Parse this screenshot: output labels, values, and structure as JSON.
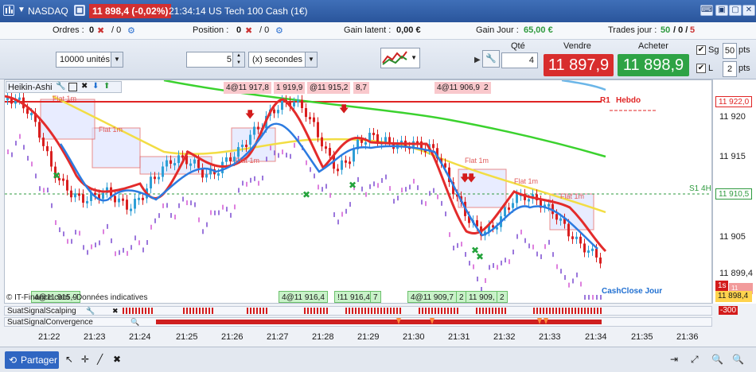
{
  "header": {
    "symbol": "NASDAQ",
    "price_change": "11 898,4 (-0,02%)",
    "title": "21:34:14 US Tech 100 Cash (1€)",
    "buttons": [
      "▣",
      "▢",
      "✕"
    ]
  },
  "stats": {
    "orders_label": "Ordres :",
    "orders_val": "0",
    "orders_pending": "/ 0",
    "position_label": "Position :",
    "position_val": "0",
    "position_pending": "/ 0",
    "gain_latent_label": "Gain latent :",
    "gain_latent_val": "0,00 €",
    "gain_jour_label": "Gain Jour :",
    "gain_jour_val": "65,00 €",
    "trades_label": "Trades jour :",
    "trades_val_1": "50",
    "trades_val_2": "/ 0 /",
    "trades_val_3": "5"
  },
  "toolbar": {
    "units": "10000 unités",
    "interval_val": "5",
    "interval_unit": "(x) secondes",
    "qty_label": "Qté",
    "qty_val": "4",
    "sell_label": "Vendre",
    "sell_price": "11 897,9",
    "buy_label": "Acheter",
    "buy_price": "11 898,9",
    "sg_label": "Sg",
    "sg_val": "50",
    "sg_unit": "pts",
    "l_label": "L",
    "l_val": "2",
    "l_unit": "pts"
  },
  "chart": {
    "indicator_name": "Heikin-Ashi",
    "tags_top": [
      "4@11 917,8",
      "1 919,9",
      "@11 915,2",
      "8,7",
      "4@11 906,9",
      "2"
    ],
    "tags_bottom": [
      "4@11 916,4",
      "!11 916,4",
      "7",
      "4@11 909,7",
      "2",
      "11 909,",
      "2",
      "4@11 915,9"
    ],
    "flat_labels": [
      "Flat 1m",
      "Flat 1m",
      "Flat 1m",
      "Flat 1m",
      "Flat 1m",
      "Flat 1m"
    ],
    "r1_label": "R1",
    "r1_period": "Hebdo",
    "s1_label": "S1 4H",
    "cash_close": "CashClose Jour",
    "copyright": "© IT-Finance.com - Données indicatives",
    "colors": {
      "up": "#2e9fd6",
      "down": "#d91f1f",
      "alt": "#8a5fd6",
      "pink": "#d86ad8",
      "ema_fast": "#e32b2b",
      "ema_slow": "#2c7be0",
      "ema_yellow": "#f2dd44",
      "ema_green": "#3bd22e"
    }
  },
  "yaxis": {
    "labels": [
      "11 920",
      "11 915",
      "11 910,5",
      "11 905",
      "11 899,4"
    ],
    "tag_r1": "11 922,0",
    "tag_s1": "11 910,5",
    "tag_last": "11 898,4",
    "tag_last_sub": "11 898,0",
    "ind_max": "-300",
    "ind_s": "1s"
  },
  "indicators": {
    "scalping": "SuatSignalScalping",
    "convergence": "SuatSignalConvergence"
  },
  "xaxis": {
    "labels": [
      "21:22",
      "21:23",
      "21:24",
      "21:25",
      "21:26",
      "21:27",
      "21:28",
      "21:29",
      "21:30",
      "21:31",
      "21:32",
      "21:33",
      "21:34",
      "21:35",
      "21:36"
    ]
  },
  "bottom": {
    "share_label": "Partager"
  }
}
